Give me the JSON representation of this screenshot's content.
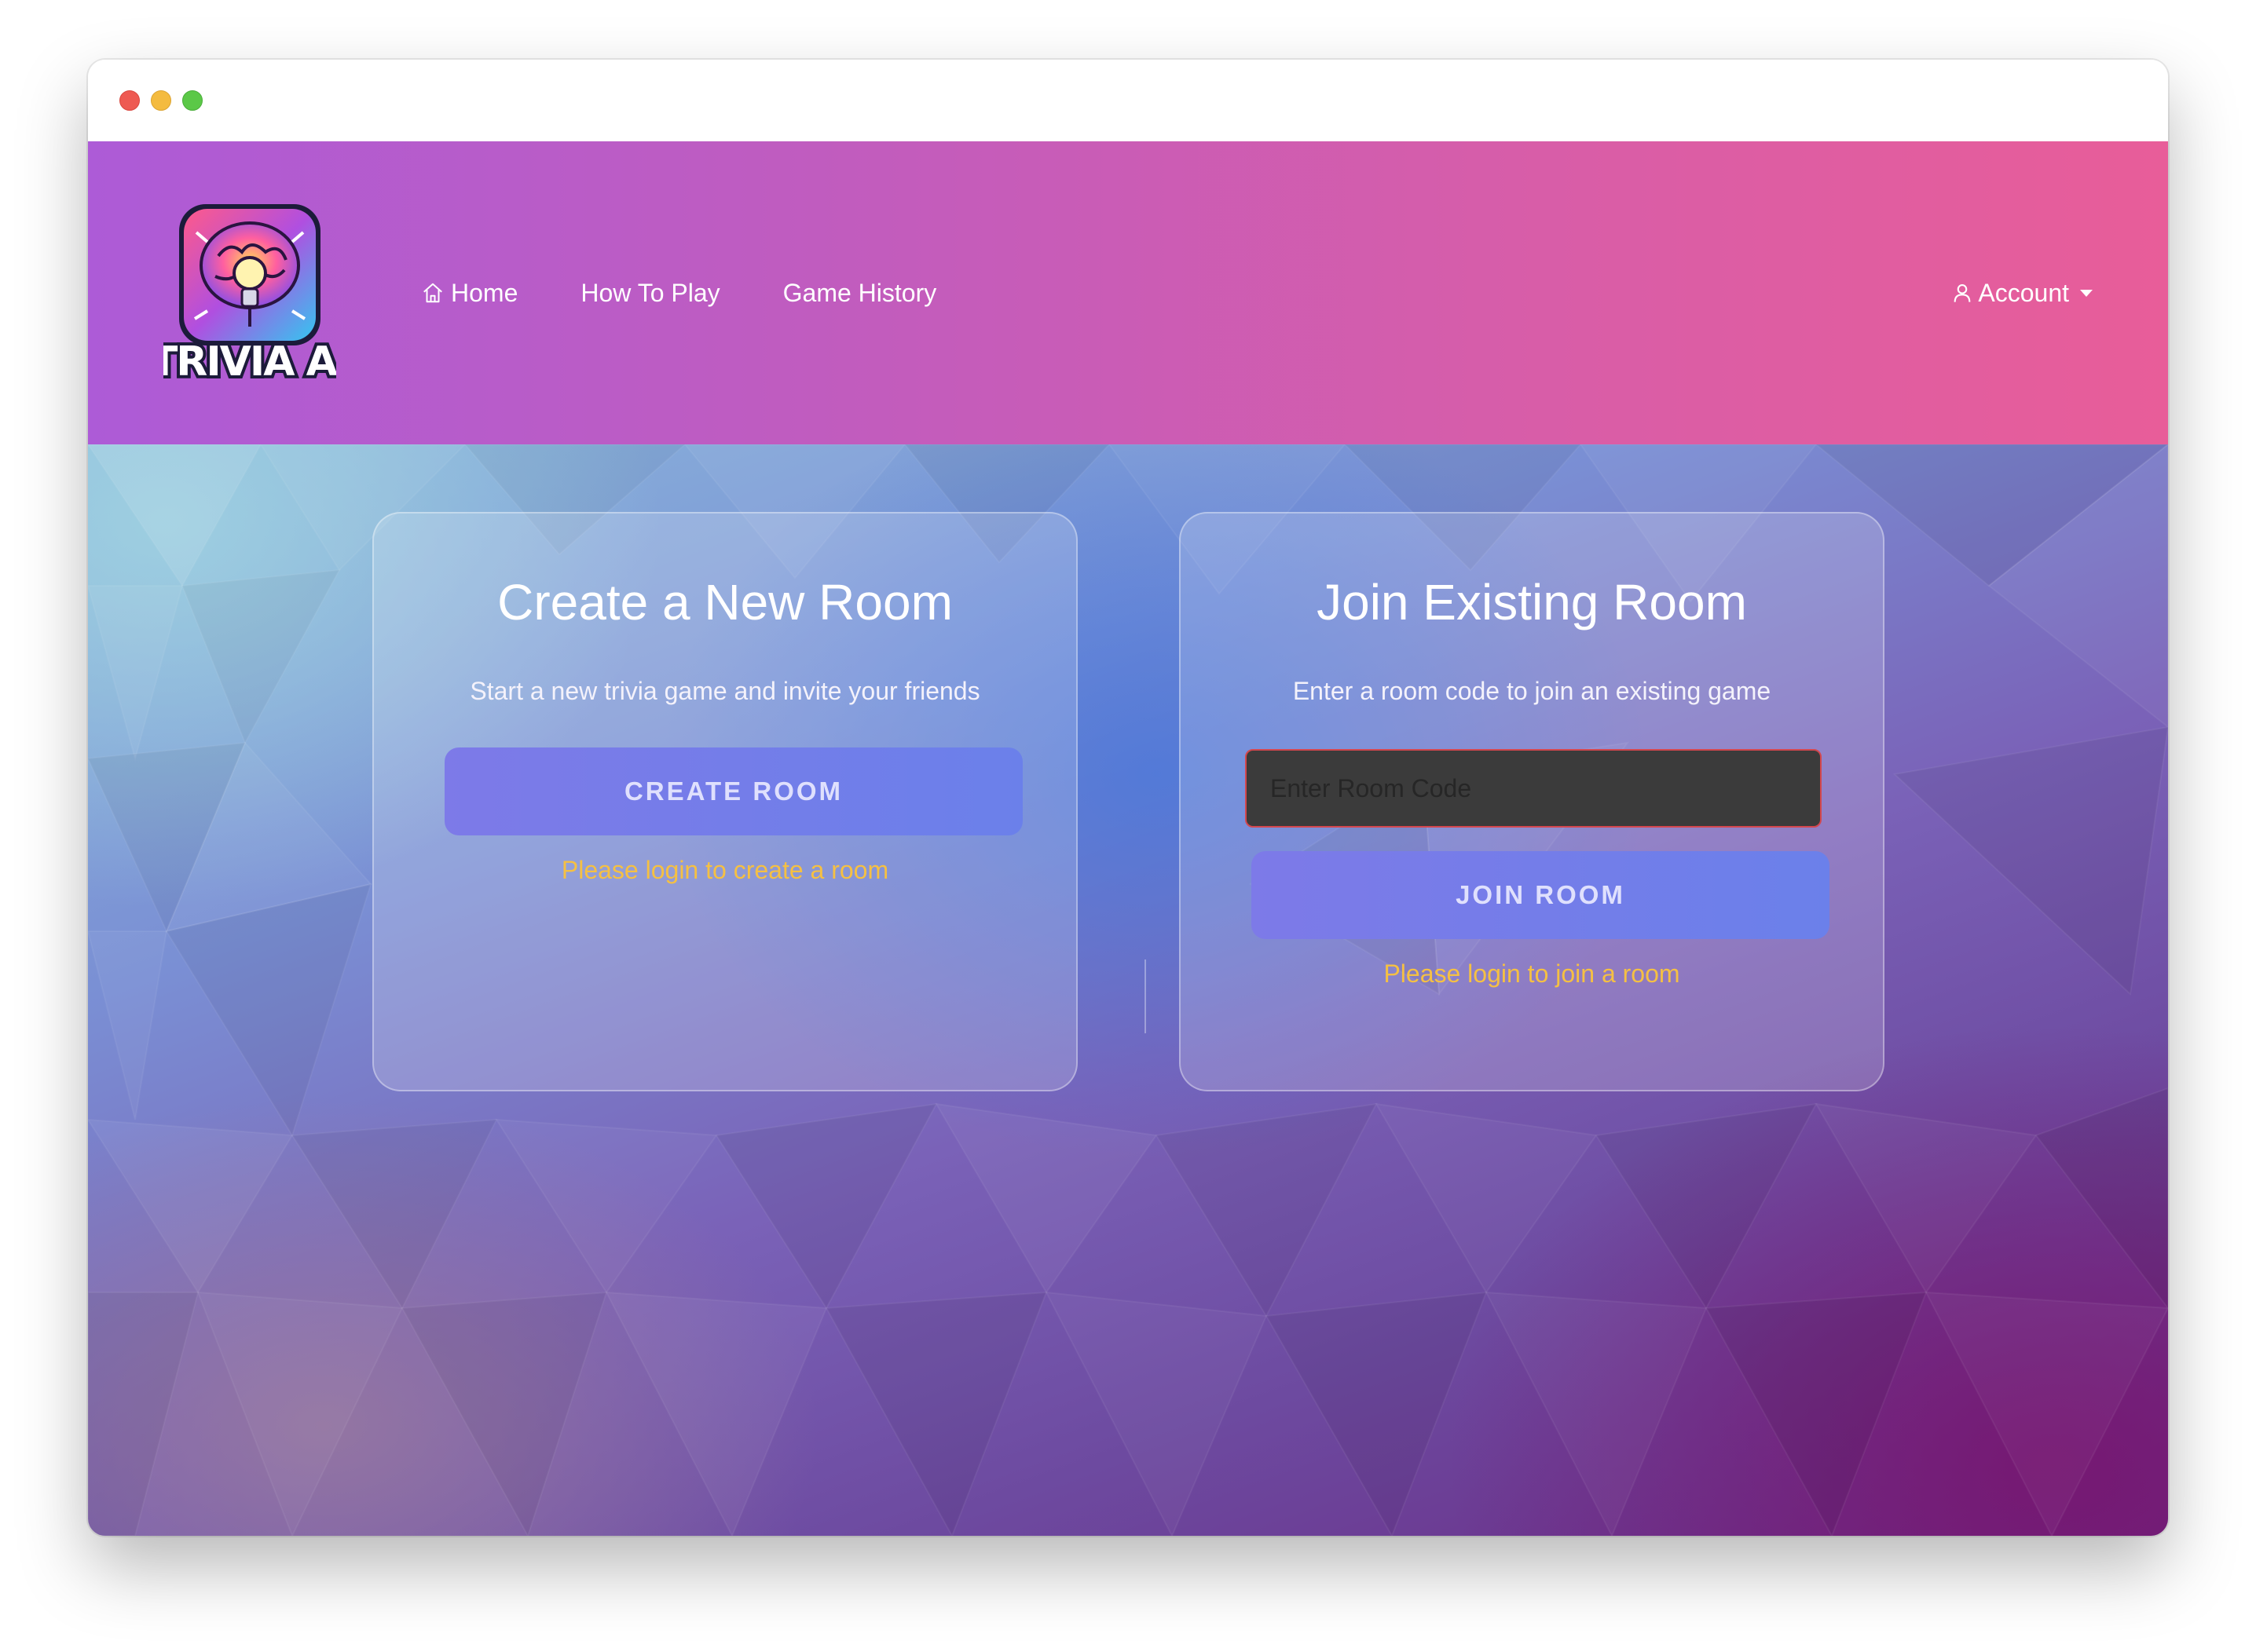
{
  "nav": {
    "logo_text": "TRIVIA AI",
    "links": [
      {
        "label": "Home",
        "icon": "home-icon"
      },
      {
        "label": "How To Play"
      },
      {
        "label": "Game History"
      }
    ],
    "account_label": "Account",
    "account_icon": "user-icon"
  },
  "create_card": {
    "title": "Create a New Room",
    "subtitle": "Start a new trivia game and invite your friends",
    "button_label": "CREATE ROOM",
    "login_notice": "Please login to create a room"
  },
  "join_card": {
    "title": "Join Existing Room",
    "subtitle": "Enter a room code to join an existing game",
    "input_placeholder": "Enter Room Code",
    "input_value": "",
    "button_label": "JOIN ROOM",
    "login_notice": "Please login to join a room"
  },
  "colors": {
    "navbar_gradient_start": "#ad5bd7",
    "navbar_gradient_end": "#e85d99",
    "button": "#7478e8",
    "notice": "#f5c043",
    "input_border": "#d4474e"
  }
}
